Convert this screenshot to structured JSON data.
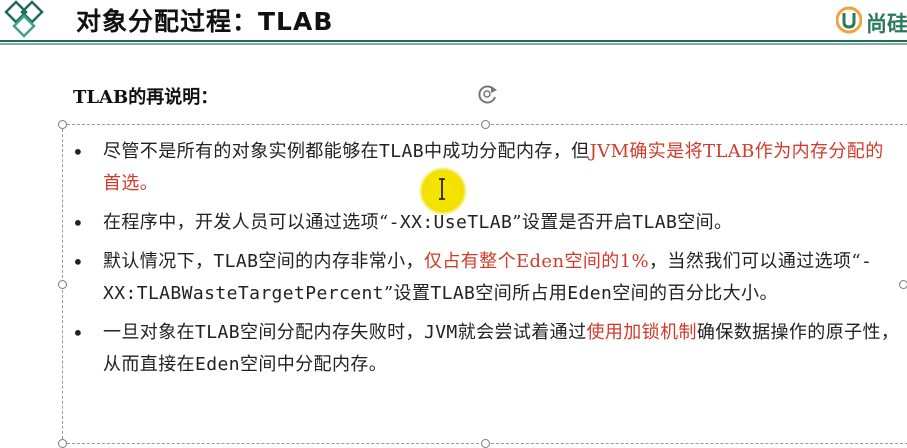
{
  "header": {
    "title": "对象分配过程：TLAB",
    "brand_text": "尚硅"
  },
  "subtitle": "TLAB的再说明：",
  "bullets": [
    {
      "parts": [
        {
          "text": "尽管不是所有的对象实例都能够在",
          "style": "normal"
        },
        {
          "text": "TLAB",
          "style": "mono"
        },
        {
          "text": "中成功分配内存，但",
          "style": "normal"
        },
        {
          "text": "JVM确实是将TLAB作为内存分配的首选。",
          "style": "red"
        }
      ]
    },
    {
      "parts": [
        {
          "text": "在程序中，开发人员可以通过选项“",
          "style": "normal"
        },
        {
          "text": "-XX:UseTLAB",
          "style": "mono"
        },
        {
          "text": "”设置是否开启",
          "style": "normal"
        },
        {
          "text": "TLAB",
          "style": "mono"
        },
        {
          "text": "空间。",
          "style": "normal"
        }
      ]
    },
    {
      "parts": [
        {
          "text": "默认情况下，",
          "style": "normal"
        },
        {
          "text": "TLAB",
          "style": "mono"
        },
        {
          "text": "空间的内存非常小，",
          "style": "normal"
        },
        {
          "text": "仅占有整个Eden空间的1%",
          "style": "red"
        },
        {
          "text": "，当然我们可以通过选项“",
          "style": "normal"
        },
        {
          "text": "-XX:TLABWasteTargetPercent",
          "style": "mono"
        },
        {
          "text": "”设置",
          "style": "normal"
        },
        {
          "text": "TLAB",
          "style": "mono"
        },
        {
          "text": "空间所占用",
          "style": "normal"
        },
        {
          "text": "Eden",
          "style": "mono"
        },
        {
          "text": "空间的百分比大小。",
          "style": "normal"
        }
      ]
    },
    {
      "parts": [
        {
          "text": "一旦对象在",
          "style": "normal"
        },
        {
          "text": "TLAB",
          "style": "mono"
        },
        {
          "text": "空间分配内存失败时，",
          "style": "normal"
        },
        {
          "text": "JVM",
          "style": "mono"
        },
        {
          "text": "就会尝试着通过",
          "style": "normal"
        },
        {
          "text": "使用加锁机制",
          "style": "red"
        },
        {
          "text": "确保数据操作的原子性，从而直接在",
          "style": "normal"
        },
        {
          "text": "Eden",
          "style": "mono"
        },
        {
          "text": "空间中分配内存。",
          "style": "normal"
        }
      ]
    }
  ],
  "icons": {
    "logo": "diamond-logo-icon",
    "brand": "brand-logo-icon",
    "rotate": "rotate-handle-icon",
    "cursor": "text-cursor-icon"
  },
  "colors": {
    "accent": "#1f6b58",
    "highlight_red": "#d23a2a",
    "cursor_highlight": "#f3e000"
  }
}
